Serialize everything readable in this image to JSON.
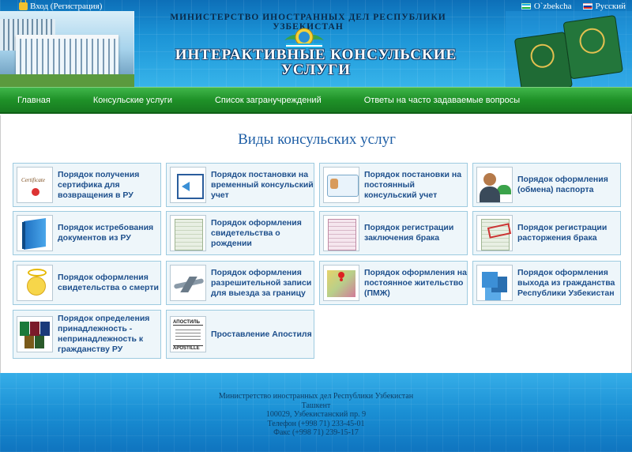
{
  "header": {
    "login_text": "Вход (Регистрация)",
    "ministry_text": "МИНИСТЕРСТВО ИНОСТРАННЫХ ДЕЛ РЕСПУБЛИКИ УЗБЕКИСТАН",
    "title_line1": "ИНТЕРАКТИВНЫЕ КОНСУЛЬСКИЕ",
    "title_line2": "УСЛУГИ",
    "languages": [
      {
        "label": "O`zbekcha",
        "flag": "uz"
      },
      {
        "label": "Русский",
        "flag": "ru"
      }
    ]
  },
  "nav": {
    "items": [
      "Главная",
      "Консульские услуги",
      "Список загранучреждений",
      "Ответы на часто задаваемые вопросы"
    ]
  },
  "main": {
    "title": "Виды консульских услуг",
    "services": [
      {
        "label": "Порядок получения сертифика для возвращения в РУ",
        "icon": "certificate-icon"
      },
      {
        "label": "Порядок постановки на временный консульский учет",
        "icon": "window-arrow-icon"
      },
      {
        "label": "Порядок постановки на постоянный консульский учет",
        "icon": "id-card-icon"
      },
      {
        "label": "Порядок оформления (обмена) паспорта",
        "icon": "person-passport-icon"
      },
      {
        "label": "Порядок истребования документов из РУ",
        "icon": "blue-book-icon"
      },
      {
        "label": "Порядок оформления свидетельства о рождении",
        "icon": "birth-certificate-icon"
      },
      {
        "label": "Порядок регистрации заключения брака",
        "icon": "marriage-certificate-icon"
      },
      {
        "label": "Порядок регистрации расторжения брака",
        "icon": "divorce-certificate-icon"
      },
      {
        "label": "Порядок оформления свидетельства о смерти",
        "icon": "angel-icon"
      },
      {
        "label": "Порядок оформления разрешительной записи для выезда за границу",
        "icon": "airplane-icon"
      },
      {
        "label": "Порядок оформления на постоянное жительство (ПМЖ)",
        "icon": "map-pin-icon"
      },
      {
        "label": "Порядок оформления выхода из гражданства Республики Узбекистан",
        "icon": "blue-cubes-icon"
      },
      {
        "label": "Порядок определения принадлежность - непринадлежность к гражданству РУ",
        "icon": "passports-stack-icon"
      },
      {
        "label": "Проставление Апостиля",
        "icon": "apostille-icon"
      }
    ]
  },
  "footer": {
    "lines": [
      "Министретство иностранных дел Республики Узбекистан",
      "Ташкент",
      "100029, Узбекистанский пр. 9",
      "Телефон (+998 71) 233-45-01",
      "Факс (+998 71) 239-15-17"
    ]
  }
}
